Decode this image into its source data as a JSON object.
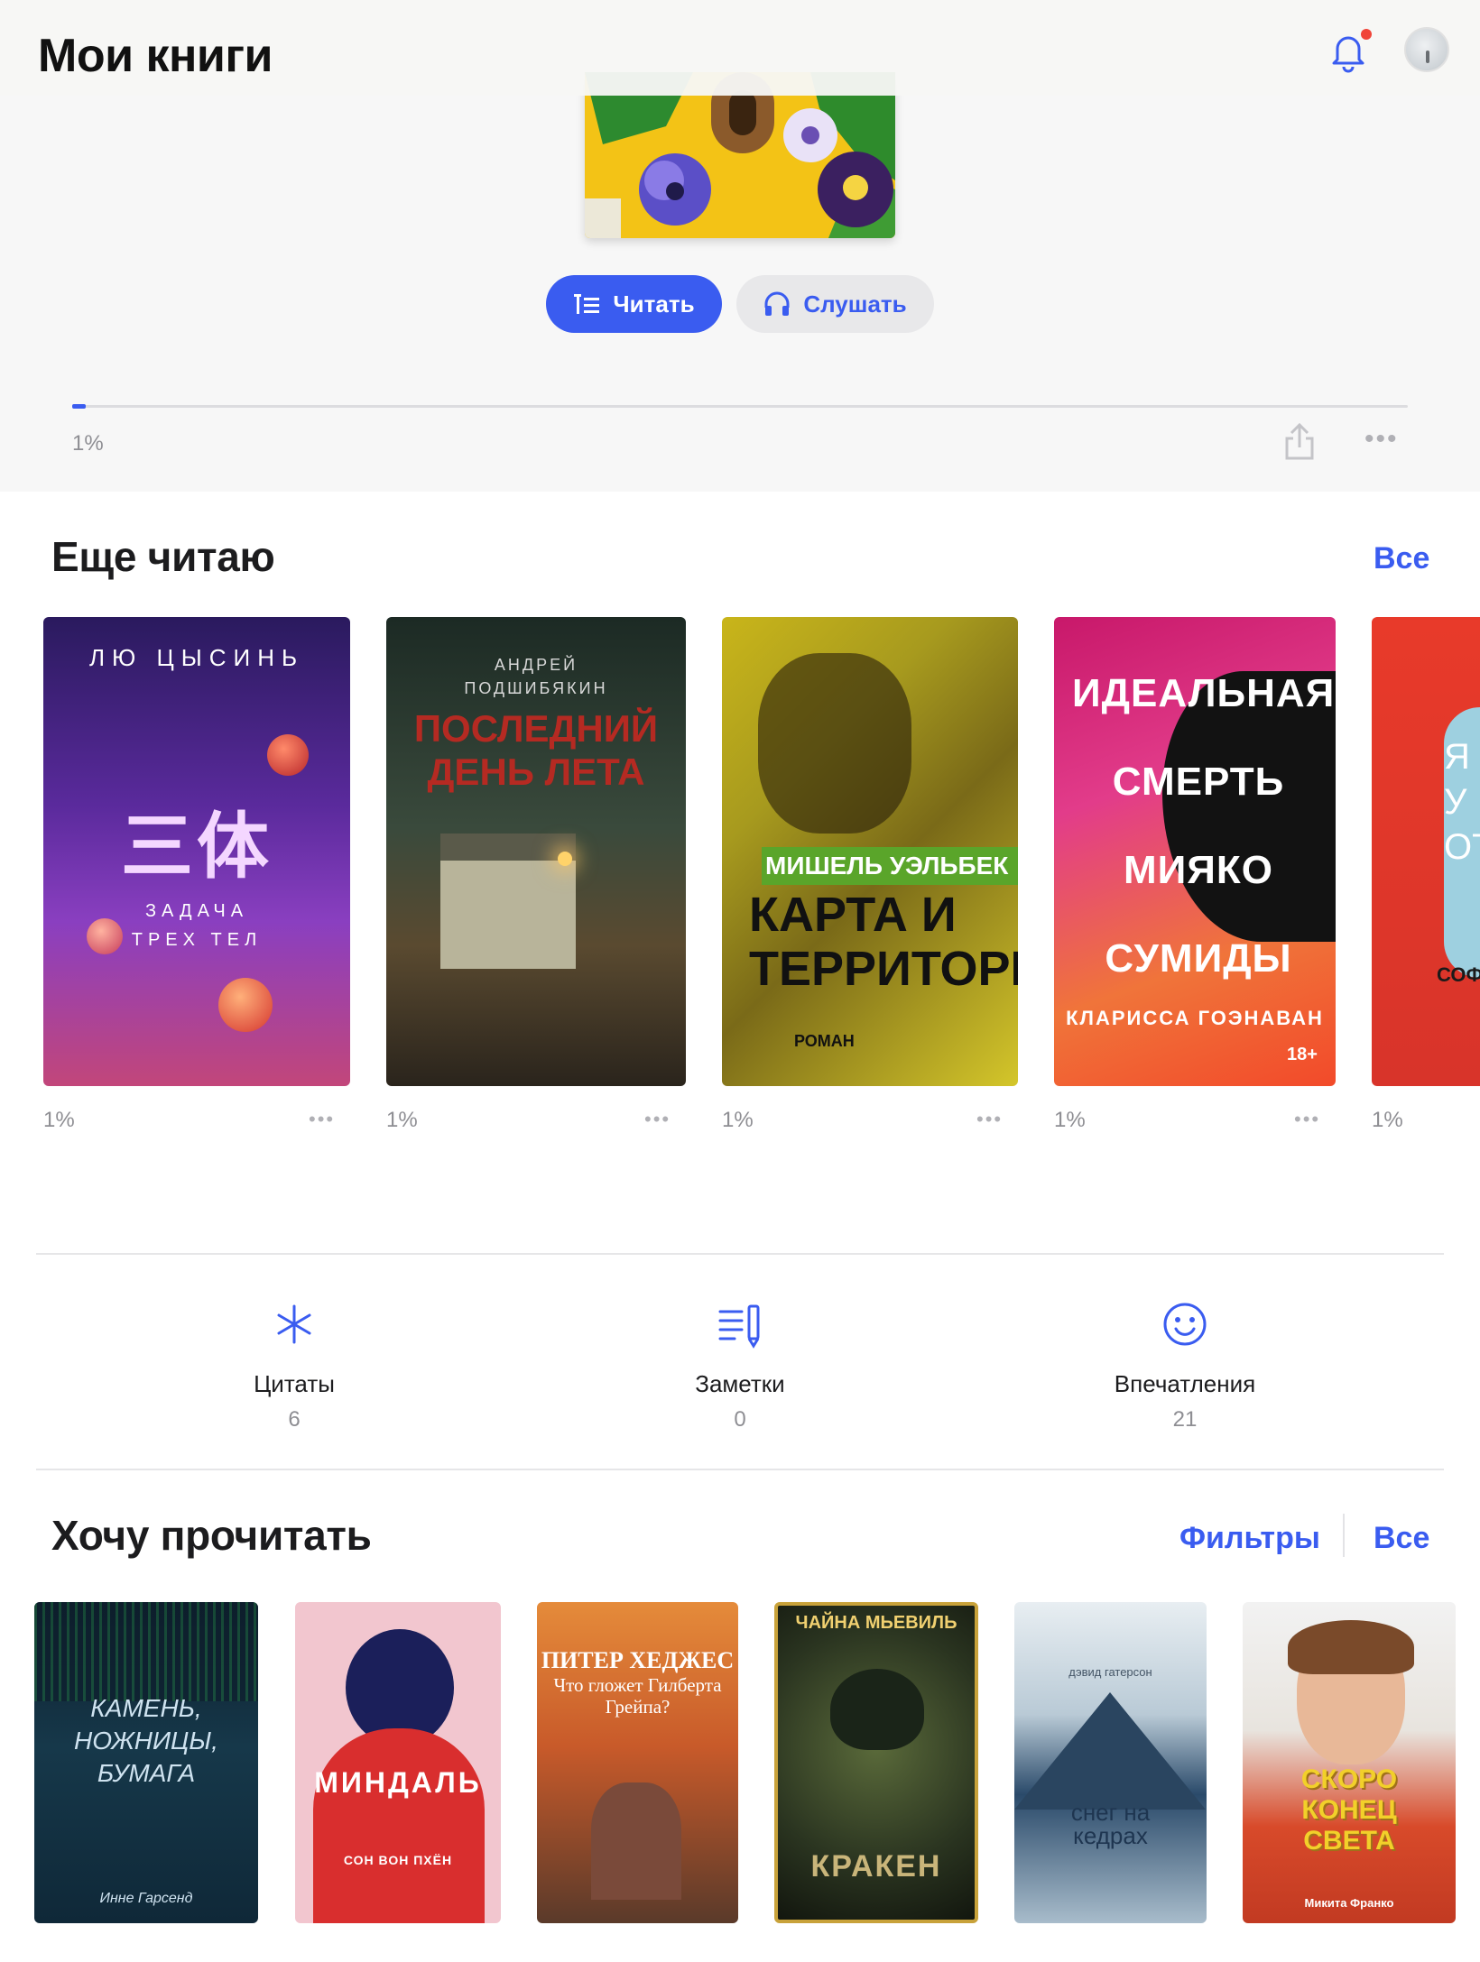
{
  "header": {
    "title": "Мои книги"
  },
  "current_book": {
    "read_label": "Читать",
    "listen_label": "Слушать",
    "progress_text": "1%",
    "progress_fraction": 0.01
  },
  "reading_section": {
    "title": "Еще читаю",
    "all_label": "Все",
    "books": [
      {
        "author": "ЛЮ ЦЫСИНЬ",
        "title": "ЗАДАЧА ТРЕХ ТЕЛ",
        "progress": "1%"
      },
      {
        "author": "АНДРЕЙ ПОДШИБЯКИН",
        "title": "ПОСЛЕДНИЙ ДЕНЬ ЛЕТА",
        "progress": "1%"
      },
      {
        "author": "МИШЕЛЬ УЭЛЬБЕК",
        "title": "КАРТА И ТЕРРИТОРИЯ",
        "subtitle": "РОМАН",
        "progress": "1%"
      },
      {
        "author": "КЛАРИССА ГОЭНАВАН",
        "title": "ИДЕАЛЬНАЯ СМЕРТЬ МИЯКО СУМИДЫ",
        "age": "18+",
        "progress": "1%"
      },
      {
        "author": "СОФИ",
        "title": "Я У ОТ",
        "progress": "1%"
      }
    ]
  },
  "stats": [
    {
      "label": "Цитаты",
      "count": "6",
      "icon": "asterisk-icon"
    },
    {
      "label": "Заметки",
      "count": "0",
      "icon": "notes-pencil-icon"
    },
    {
      "label": "Впечатления",
      "count": "21",
      "icon": "smile-icon"
    }
  ],
  "want_section": {
    "title": "Хочу прочитать",
    "filters_label": "Фильтры",
    "all_label": "Все",
    "books": [
      {
        "title": "КАМЕНЬ, НОЖНИЦЫ, БУМАГА",
        "author": "Инне Гарсенд"
      },
      {
        "title": "МИНДАЛЬ",
        "author": "СОН ВОН ПХЁН"
      },
      {
        "author": "ПИТЕР ХЕДЖЕС",
        "title": "Что гложет Гилберта Грейпа?"
      },
      {
        "author": "ЧАЙНА МЬЕВИЛЬ",
        "title": "КРАКЕН"
      },
      {
        "author": "дэвид гатерсон",
        "title": "снег на кедрах"
      },
      {
        "title": "СКОРО КОНЕЦ СВЕТА",
        "author": "Микита Франко"
      }
    ]
  },
  "colors": {
    "accent": "#3a5cf0",
    "notification_dot": "#f04438"
  }
}
